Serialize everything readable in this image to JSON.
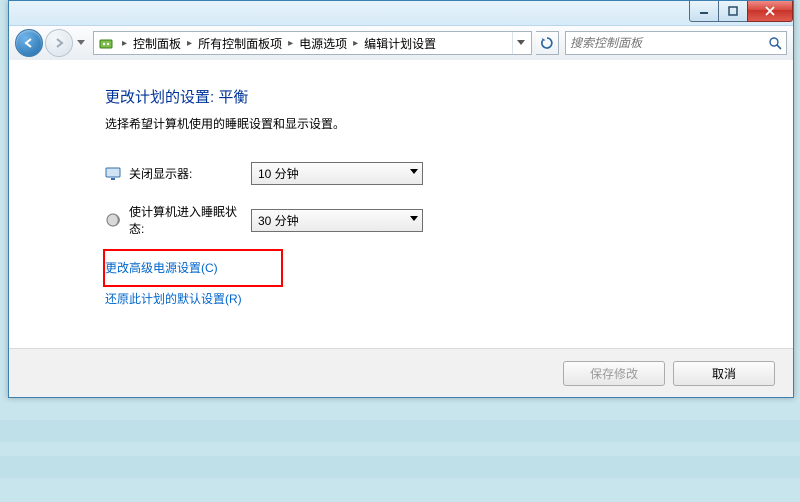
{
  "breadcrumb": {
    "items": [
      "控制面板",
      "所有控制面板项",
      "电源选项",
      "编辑计划设置"
    ]
  },
  "search": {
    "placeholder": "搜索控制面板"
  },
  "page": {
    "heading": "更改计划的设置: 平衡",
    "subtext": "选择希望计算机使用的睡眠设置和显示设置。"
  },
  "settings": {
    "display_off": {
      "label": "关闭显示器:",
      "value": "10 分钟"
    },
    "sleep": {
      "label": "使计算机进入睡眠状态:",
      "value": "30 分钟"
    }
  },
  "links": {
    "advanced": "更改高级电源设置(C)",
    "restore": "还原此计划的默认设置(R)"
  },
  "buttons": {
    "save": "保存修改",
    "cancel": "取消"
  }
}
